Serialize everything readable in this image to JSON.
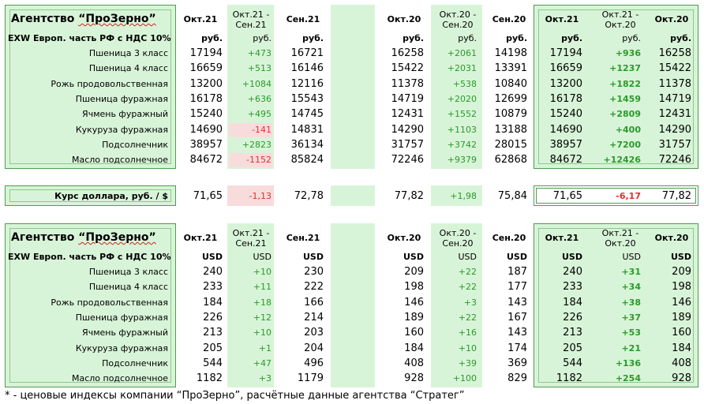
{
  "title_prefix": "Агентство ",
  "title_name": "“ПроЗерно”",
  "basis_label": "EXW Европ. часть РФ с НДС 10%",
  "products": [
    "Пшеница 3 класс",
    "Пшеница 4 класс",
    "Рожь продовольственная",
    "Пшеница фуражная",
    "Ячмень фуражный",
    "Кукуруза фуражная",
    "Подсолнечник",
    "Масло подсолнечное"
  ],
  "headers": [
    "Окт.21",
    "Окт.21 -\nСен.21",
    "Сен.21",
    "Окт.20",
    "Окт.20 -\nСен.20",
    "Сен.20",
    "Окт.21",
    "Окт.21 -\nОкт.20",
    "Окт.20"
  ],
  "rub": {
    "units": [
      "руб.",
      "руб.",
      "руб.",
      "руб.",
      "руб.",
      "руб.",
      "руб.",
      "руб.",
      "руб."
    ],
    "rows": [
      [
        "17194",
        "+473",
        "16721",
        "16258",
        "+2061",
        "14198",
        "17194",
        "+936",
        "16258"
      ],
      [
        "16659",
        "+513",
        "16146",
        "15422",
        "+2031",
        "13391",
        "16659",
        "+1237",
        "15422"
      ],
      [
        "13200",
        "+1084",
        "12116",
        "11378",
        "+538",
        "10840",
        "13200",
        "+1822",
        "11378"
      ],
      [
        "16178",
        "+636",
        "15543",
        "14719",
        "+2020",
        "12699",
        "16178",
        "+1459",
        "14719"
      ],
      [
        "15240",
        "+495",
        "14745",
        "12431",
        "+1552",
        "10879",
        "15240",
        "+2809",
        "12431"
      ],
      [
        "14690",
        "-141",
        "14831",
        "14290",
        "+1103",
        "13188",
        "14690",
        "+400",
        "14290"
      ],
      [
        "38957",
        "+2823",
        "36134",
        "31757",
        "+3742",
        "28015",
        "38957",
        "+7200",
        "31757"
      ],
      [
        "84672",
        "-1152",
        "85824",
        "72246",
        "+9379",
        "62868",
        "84672",
        "+12426",
        "72246"
      ]
    ]
  },
  "fx": {
    "label": "Курс доллара, руб. / $",
    "values": [
      "71,65",
      "-1,13",
      "72,78",
      "",
      "77,82",
      "+1,98",
      "75,84",
      "71,65",
      "-6,17",
      "77,82"
    ]
  },
  "usd": {
    "units": [
      "USD",
      "USD",
      "USD",
      "USD",
      "USD",
      "USD",
      "USD",
      "USD",
      "USD"
    ],
    "rows": [
      [
        "240",
        "+10",
        "230",
        "209",
        "+22",
        "187",
        "240",
        "+31",
        "209"
      ],
      [
        "233",
        "+11",
        "222",
        "198",
        "+22",
        "177",
        "233",
        "+34",
        "198"
      ],
      [
        "184",
        "+18",
        "166",
        "146",
        "+3",
        "143",
        "184",
        "+38",
        "146"
      ],
      [
        "226",
        "+12",
        "214",
        "189",
        "+22",
        "167",
        "226",
        "+37",
        "189"
      ],
      [
        "213",
        "+10",
        "203",
        "160",
        "+16",
        "143",
        "213",
        "+53",
        "160"
      ],
      [
        "205",
        "+1",
        "204",
        "184",
        "+10",
        "174",
        "205",
        "+21",
        "184"
      ],
      [
        "544",
        "+47",
        "496",
        "408",
        "+39",
        "369",
        "544",
        "+136",
        "408"
      ],
      [
        "1182",
        "+3",
        "1179",
        "928",
        "+100",
        "829",
        "1182",
        "+254",
        "928"
      ]
    ]
  },
  "footnote": "* - ценовые индексы компании “ПроЗерно”, расчётные данные агентства “Стратег”",
  "colors": {
    "green_fill": "#d8f4d8",
    "border": "#4f9a4f",
    "positive": "#2a9a2a",
    "negative": "#e03030",
    "negative_fill": "#f8dcdc"
  }
}
